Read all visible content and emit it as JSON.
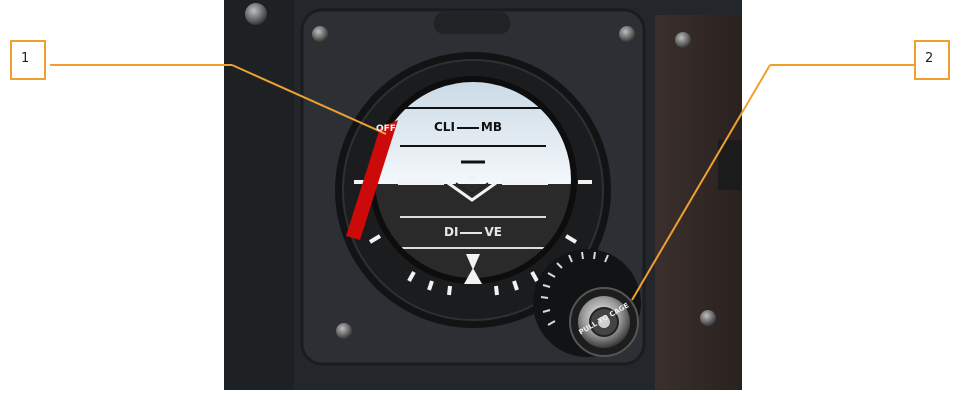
{
  "callouts": [
    {
      "label": "1"
    },
    {
      "label": "2"
    }
  ],
  "instrument": {
    "off_flag": "OFF",
    "climb_label_left": "CLI",
    "climb_label_right": "MB",
    "dive_label_left": "DI",
    "dive_label_right": "VE",
    "knob_text": "PULL TO CAGE"
  },
  "colors": {
    "callout_border": "#f0a030",
    "leader_line": "#f0a030",
    "off_flag": "#cc0a0a",
    "sky": "#dde8f2",
    "ground": "#2a2a2a",
    "panel": "#2b2e31"
  }
}
